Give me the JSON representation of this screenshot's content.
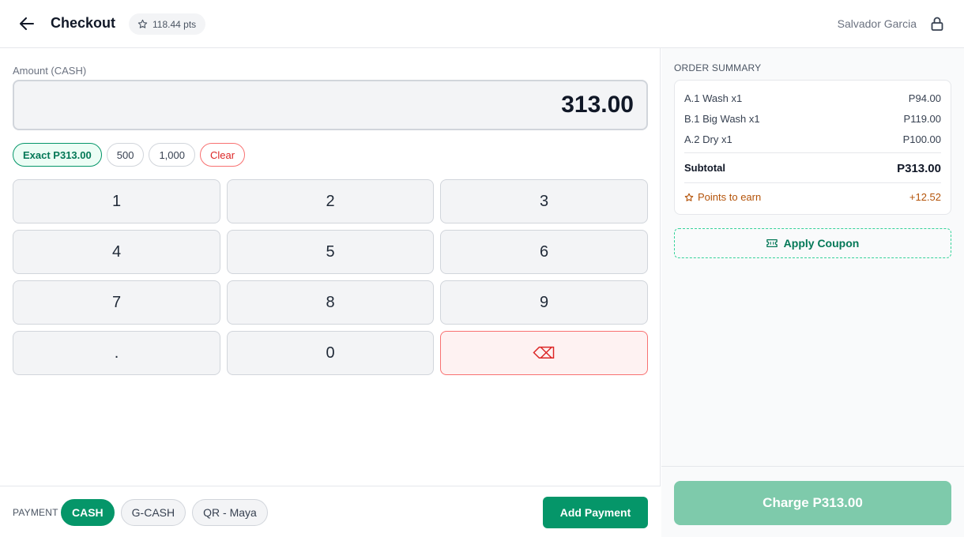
{
  "header": {
    "title": "Checkout",
    "points": "118.44 pts",
    "user": "Salvador Garcia"
  },
  "amount": {
    "label": "Amount (CASH)",
    "value": "313.00"
  },
  "quick_amounts": {
    "exact": "Exact P313.00",
    "q500": "500",
    "q1000": "1,000",
    "clear": "Clear"
  },
  "keypad": {
    "k1": "1",
    "k2": "2",
    "k3": "3",
    "k4": "4",
    "k5": "5",
    "k6": "6",
    "k7": "7",
    "k8": "8",
    "k9": "9",
    "kdot": ".",
    "k0": "0",
    "kback": "⌫"
  },
  "payment": {
    "label": "PAYMENT",
    "methods": [
      "CASH",
      "G-CASH",
      "QR - Maya"
    ],
    "selected": "CASH",
    "add_label": "Add Payment"
  },
  "summary": {
    "title": "ORDER SUMMARY",
    "items": [
      {
        "name": "A.1 Wash x1",
        "price": "P94.00"
      },
      {
        "name": "B.1 Big Wash x1",
        "price": "P119.00"
      },
      {
        "name": "A.2 Dry x1",
        "price": "P100.00"
      }
    ],
    "subtotal_label": "Subtotal",
    "subtotal_value": "P313.00",
    "points_label": "Points to earn",
    "points_value": "+12.52"
  },
  "coupon_label": "Apply Coupon",
  "charge_label": "Charge P313.00",
  "colors": {
    "accent": "#059669",
    "charge_disabled": "#7ecaab",
    "danger": "#dc2626",
    "points": "#b45309"
  }
}
